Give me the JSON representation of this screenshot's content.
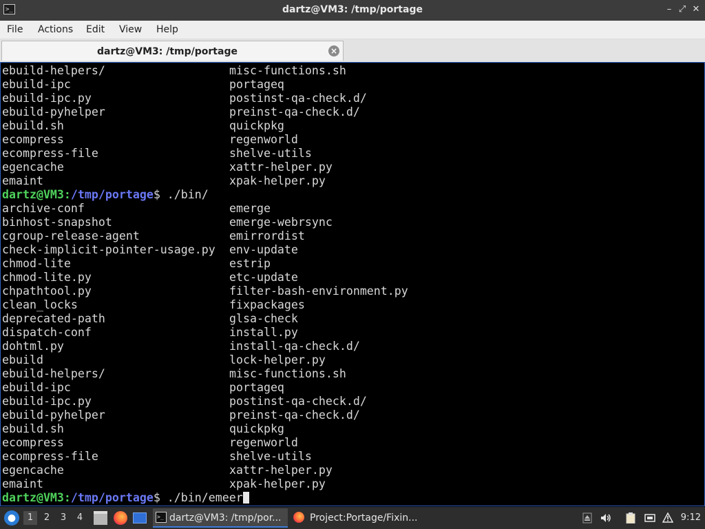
{
  "window": {
    "title": "dartz@VM3: /tmp/portage",
    "app_icon_glyph": ">_",
    "buttons": {
      "minimize": "–",
      "maximize": "⤢",
      "close": "✕"
    }
  },
  "menubar": {
    "items": [
      "File",
      "Actions",
      "Edit",
      "View",
      "Help"
    ]
  },
  "tab": {
    "label": "dartz@VM3: /tmp/portage",
    "close_glyph": "×"
  },
  "terminal": {
    "prompt": {
      "user_host": "dartz@VM3",
      "separator": ":",
      "path": "/tmp/portage",
      "suffix": "$ "
    },
    "lines": [
      {
        "type": "cols",
        "left": "ebuild-helpers/",
        "right": "misc-functions.sh"
      },
      {
        "type": "cols",
        "left": "ebuild-ipc",
        "right": "portageq"
      },
      {
        "type": "cols",
        "left": "ebuild-ipc.py",
        "right": "postinst-qa-check.d/"
      },
      {
        "type": "cols",
        "left": "ebuild-pyhelper",
        "right": "preinst-qa-check.d/"
      },
      {
        "type": "cols",
        "left": "ebuild.sh",
        "right": "quickpkg"
      },
      {
        "type": "cols",
        "left": "ecompress",
        "right": "regenworld"
      },
      {
        "type": "cols",
        "left": "ecompress-file",
        "right": "shelve-utils"
      },
      {
        "type": "cols",
        "left": "egencache",
        "right": "xattr-helper.py"
      },
      {
        "type": "cols",
        "left": "emaint",
        "right": "xpak-helper.py"
      },
      {
        "type": "prompt",
        "command": "./bin/"
      },
      {
        "type": "cols",
        "left": "archive-conf",
        "right": "emerge"
      },
      {
        "type": "cols",
        "left": "binhost-snapshot",
        "right": "emerge-webrsync"
      },
      {
        "type": "cols",
        "left": "cgroup-release-agent",
        "right": "emirrordist"
      },
      {
        "type": "cols",
        "left": "check-implicit-pointer-usage.py",
        "right": "env-update"
      },
      {
        "type": "cols",
        "left": "chmod-lite",
        "right": "estrip"
      },
      {
        "type": "cols",
        "left": "chmod-lite.py",
        "right": "etc-update"
      },
      {
        "type": "cols",
        "left": "chpathtool.py",
        "right": "filter-bash-environment.py"
      },
      {
        "type": "cols",
        "left": "clean_locks",
        "right": "fixpackages"
      },
      {
        "type": "cols",
        "left": "deprecated-path",
        "right": "glsa-check"
      },
      {
        "type": "cols",
        "left": "dispatch-conf",
        "right": "install.py"
      },
      {
        "type": "cols",
        "left": "dohtml.py",
        "right": "install-qa-check.d/"
      },
      {
        "type": "cols",
        "left": "ebuild",
        "right": "lock-helper.py"
      },
      {
        "type": "cols",
        "left": "ebuild-helpers/",
        "right": "misc-functions.sh"
      },
      {
        "type": "cols",
        "left": "ebuild-ipc",
        "right": "portageq"
      },
      {
        "type": "cols",
        "left": "ebuild-ipc.py",
        "right": "postinst-qa-check.d/"
      },
      {
        "type": "cols",
        "left": "ebuild-pyhelper",
        "right": "preinst-qa-check.d/"
      },
      {
        "type": "cols",
        "left": "ebuild.sh",
        "right": "quickpkg"
      },
      {
        "type": "cols",
        "left": "ecompress",
        "right": "regenworld"
      },
      {
        "type": "cols",
        "left": "ecompress-file",
        "right": "shelve-utils"
      },
      {
        "type": "cols",
        "left": "egencache",
        "right": "xattr-helper.py"
      },
      {
        "type": "cols",
        "left": "emaint",
        "right": "xpak-helper.py"
      },
      {
        "type": "prompt",
        "command": "./bin/emeer",
        "cursor": true
      }
    ]
  },
  "taskbar": {
    "workspaces": [
      "1",
      "2",
      "3",
      "4"
    ],
    "active_workspace": "1",
    "launchers": [
      "file-manager-icon",
      "firefox-icon",
      "show-desktop-icon"
    ],
    "tasks": [
      {
        "label": "dartz@VM3: /tmp/por...",
        "icon": "terminal-icon",
        "active": true
      },
      {
        "label": "Project:Portage/Fixin...",
        "icon": "firefox-icon",
        "active": false
      }
    ],
    "tray": [
      "eject-icon",
      "volume-icon",
      "clipboard-icon",
      "network-icon",
      "notification-icon"
    ],
    "clock": "9:12"
  }
}
